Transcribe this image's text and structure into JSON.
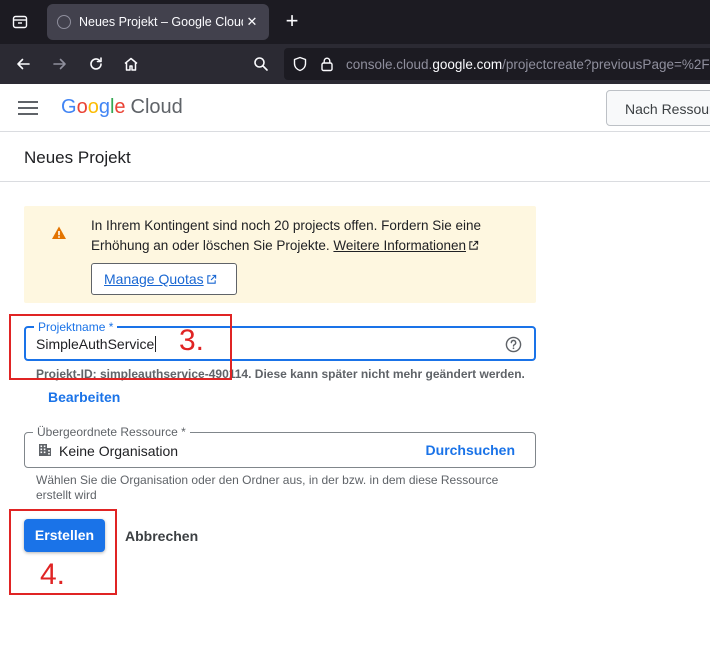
{
  "browser": {
    "tab_title": "Neues Projekt – Google Cloud C",
    "tab_close": "✕",
    "new_tab": "+",
    "url_prefix": "console.cloud.",
    "url_host": "google.com",
    "url_path": "/projectcreate?previousPage=%2F"
  },
  "header": {
    "logo_google": [
      "G",
      "o",
      "o",
      "g",
      "l",
      "e"
    ],
    "logo_google_colors": [
      "#4285f4",
      "#ea4335",
      "#fbbc05",
      "#4285f4",
      "#34a853",
      "#ea4335"
    ],
    "logo_cloud": "Cloud",
    "search_label": "Nach Ressour"
  },
  "page": {
    "title": "Neues Projekt"
  },
  "quota_banner": {
    "text": "In Ihrem Kontingent sind noch 20 projects offen. Fordern Sie eine Erhöhung an oder löschen Sie Projekte.",
    "link": "Weitere Informationen",
    "button": "Manage Quotas"
  },
  "project_name": {
    "label": "Projektname *",
    "value": "SimpleAuthService"
  },
  "project_id_hint": "Projekt-ID: simpleauthservice-490114. Diese kann später nicht mehr geändert werden.",
  "edit_link": "Bearbeiten",
  "parent_resource": {
    "label": "Übergeordnete Ressource *",
    "value": "Keine Organisation",
    "browse": "Durchsuchen",
    "hint": "Wählen Sie die Organisation oder den Ordner aus, in der bzw. in dem diese Ressource erstellt wird"
  },
  "actions": {
    "create": "Erstellen",
    "cancel": "Abbrechen"
  },
  "annotations": {
    "step3": "3.",
    "step4": "4."
  },
  "colors": {
    "accent": "#1a73e8",
    "warning": "#e37400",
    "annotation": "#e02424",
    "banner_bg": "#fef7e0"
  }
}
